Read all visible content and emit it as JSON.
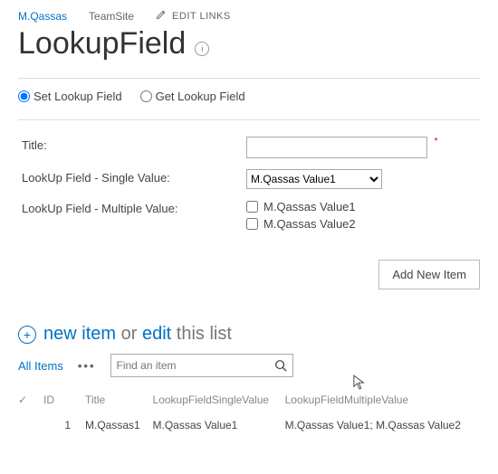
{
  "breadcrumb": {
    "root": "M.Qassas",
    "site": "TeamSite",
    "edit_links": "EDIT LINKS"
  },
  "page": {
    "title": "LookupField"
  },
  "mode": {
    "set_label": "Set Lookup Field",
    "get_label": "Get Lookup Field",
    "selected": "set"
  },
  "form": {
    "title_label": "Title:",
    "title_value": "",
    "single_label": "LookUp Field - Single Value:",
    "single_selected": "M.Qassas Value1",
    "multi_label": "LookUp Field - Multiple Value:",
    "multi_options": {
      "opt1": "M.Qassas Value1",
      "opt2": "M.Qassas Value2"
    },
    "add_button": "Add New Item"
  },
  "list_actions": {
    "new_item": "new item",
    "or": "or",
    "edit": "edit",
    "rest": "this list"
  },
  "views": {
    "current": "All Items",
    "search_placeholder": "Find an item"
  },
  "columns": {
    "check": "✓",
    "id": "ID",
    "title": "Title",
    "single": "LookupFieldSingleValue",
    "multi": "LookupFieldMultipleValue"
  },
  "row1": {
    "id": "1",
    "title": "M.Qassas1",
    "single": "M.Qassas Value1",
    "multi": "M.Qassas Value1; M.Qassas Value2"
  }
}
